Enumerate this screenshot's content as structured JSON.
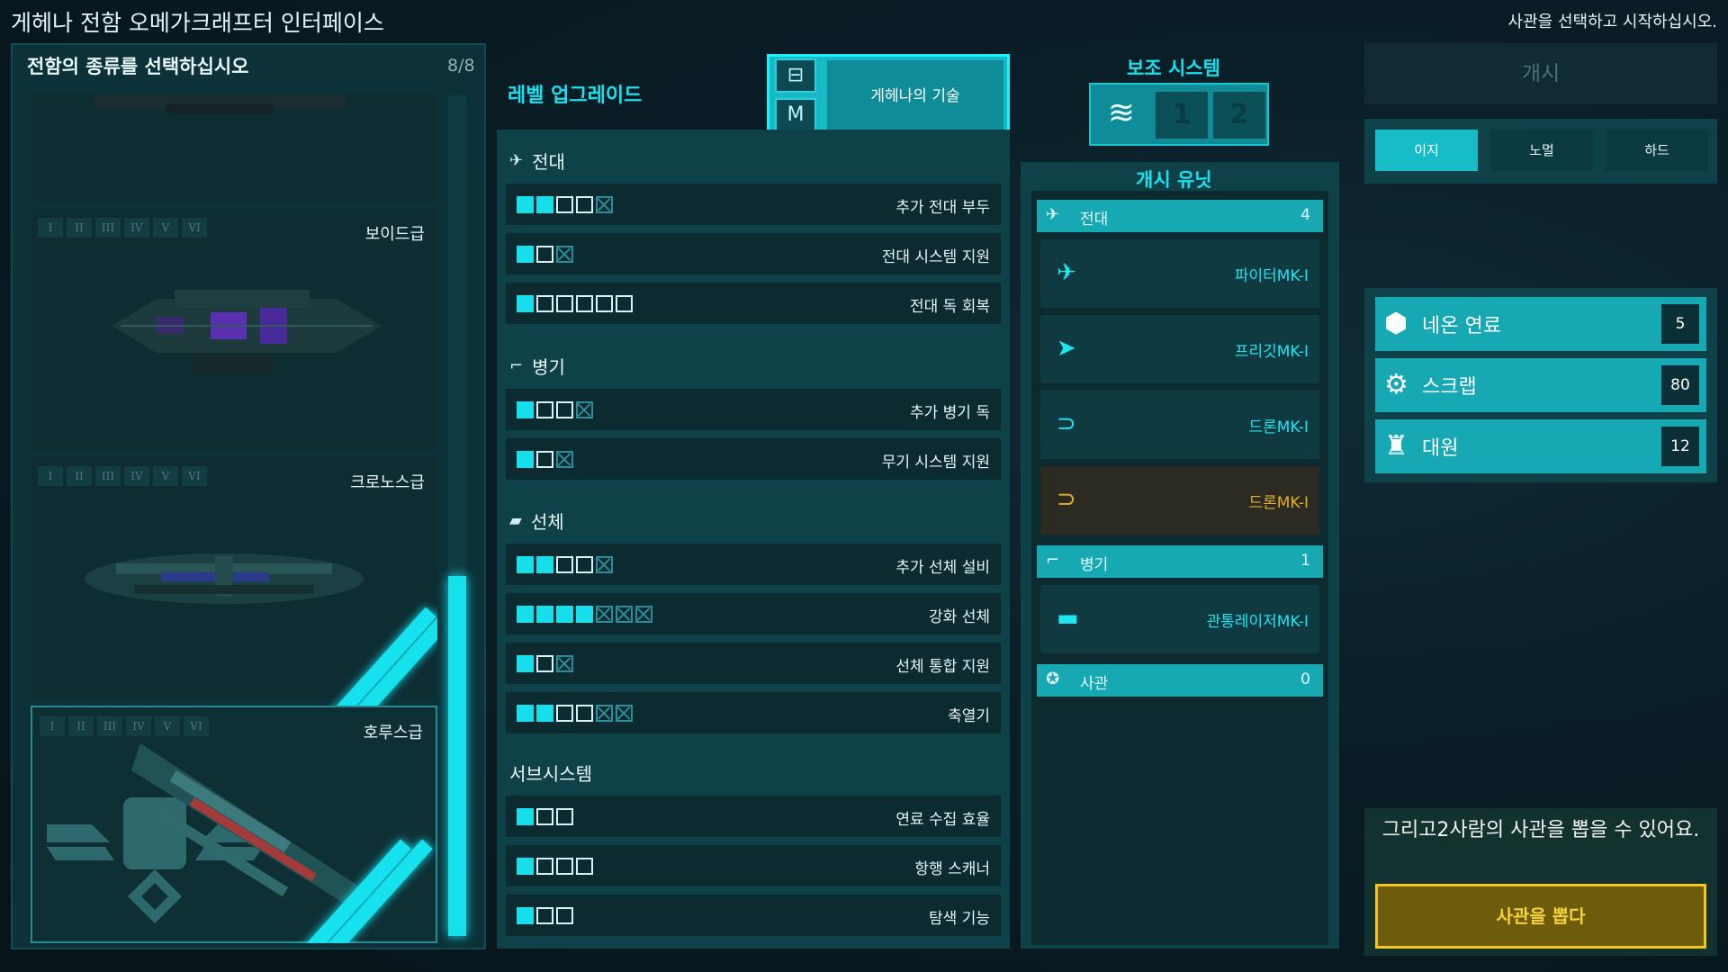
{
  "window_title": "게헤나 전함 오메가크래프터 인터페이스",
  "top_hint": "사관을 선택하고 시작하십시오.",
  "ship_select": {
    "header": "전함의 종류를 선택하십시오",
    "count": "8/8",
    "tiers": [
      "I",
      "II",
      "III",
      "IV",
      "V",
      "VI"
    ],
    "ships": [
      {
        "name": "보이드급"
      },
      {
        "name": "크로노스급"
      },
      {
        "name": "호루스급"
      }
    ]
  },
  "upgrades": {
    "title": "레벨 업그레이드",
    "tech_label": "게헤나의 기술",
    "sections": [
      {
        "name": "전대",
        "icon": "fleet-icon",
        "rows": [
          {
            "label": "추가 전대 부두",
            "on": 2,
            "off": 2,
            "locked": 1
          },
          {
            "label": "전대 시스템 지원",
            "on": 1,
            "off": 1,
            "locked": 1
          },
          {
            "label": "전대 독 회복",
            "on": 1,
            "off": 5,
            "locked": 0
          }
        ]
      },
      {
        "name": "병기",
        "icon": "weapon-icon",
        "rows": [
          {
            "label": "추가 병기 독",
            "on": 1,
            "off": 2,
            "locked": 1
          },
          {
            "label": "무기 시스템 지원",
            "on": 1,
            "off": 1,
            "locked": 1
          }
        ]
      },
      {
        "name": "선체",
        "icon": "hull-icon",
        "rows": [
          {
            "label": "추가 선체 설비",
            "on": 2,
            "off": 2,
            "locked": 1
          },
          {
            "label": "강화 선체",
            "on": 4,
            "off": 0,
            "locked": 3
          },
          {
            "label": "선체 통합 지원",
            "on": 1,
            "off": 1,
            "locked": 1
          },
          {
            "label": "축열기",
            "on": 2,
            "off": 2,
            "locked": 2
          }
        ]
      },
      {
        "name": "서브시스템",
        "icon": "",
        "rows": [
          {
            "label": "연료 수집 효율",
            "on": 1,
            "off": 2,
            "locked": 0
          },
          {
            "label": "항행 스캐너",
            "on": 1,
            "off": 3,
            "locked": 0
          },
          {
            "label": "탐색 기능",
            "on": 1,
            "off": 2,
            "locked": 0
          }
        ]
      }
    ]
  },
  "aux": {
    "title": "보조 시스템",
    "slots": [
      "1",
      "2"
    ]
  },
  "starting_units": {
    "title": "개시 유닛",
    "categories": [
      {
        "name": "전대",
        "count": "4"
      },
      {
        "name": "병기",
        "count": "1"
      },
      {
        "name": "사관",
        "count": "0"
      }
    ],
    "units": [
      {
        "name": "파이터MK-I"
      },
      {
        "name": "프리깃MK-I"
      },
      {
        "name": "드론MK-I"
      },
      {
        "name": "드론MK-I"
      },
      {
        "name": "관통레이저MK-I"
      }
    ]
  },
  "start_button": "개시",
  "difficulty": {
    "options": [
      "이지",
      "노멀",
      "하드"
    ],
    "selected": "이지"
  },
  "resources": [
    {
      "name": "네온 연료",
      "value": "5",
      "icon": "fuel-icon"
    },
    {
      "name": "스크랩",
      "value": "80",
      "icon": "scrap-gear-icon"
    },
    {
      "name": "대원",
      "value": "12",
      "icon": "crew-icon"
    }
  ],
  "draft": {
    "text": "그리고2사람의 사관을 뽑을 수 있어요.",
    "button": "사관을 뽑다"
  },
  "colors": {
    "accent": "#16dfeb",
    "warning": "#e3b127",
    "panel": "#0f4148"
  }
}
